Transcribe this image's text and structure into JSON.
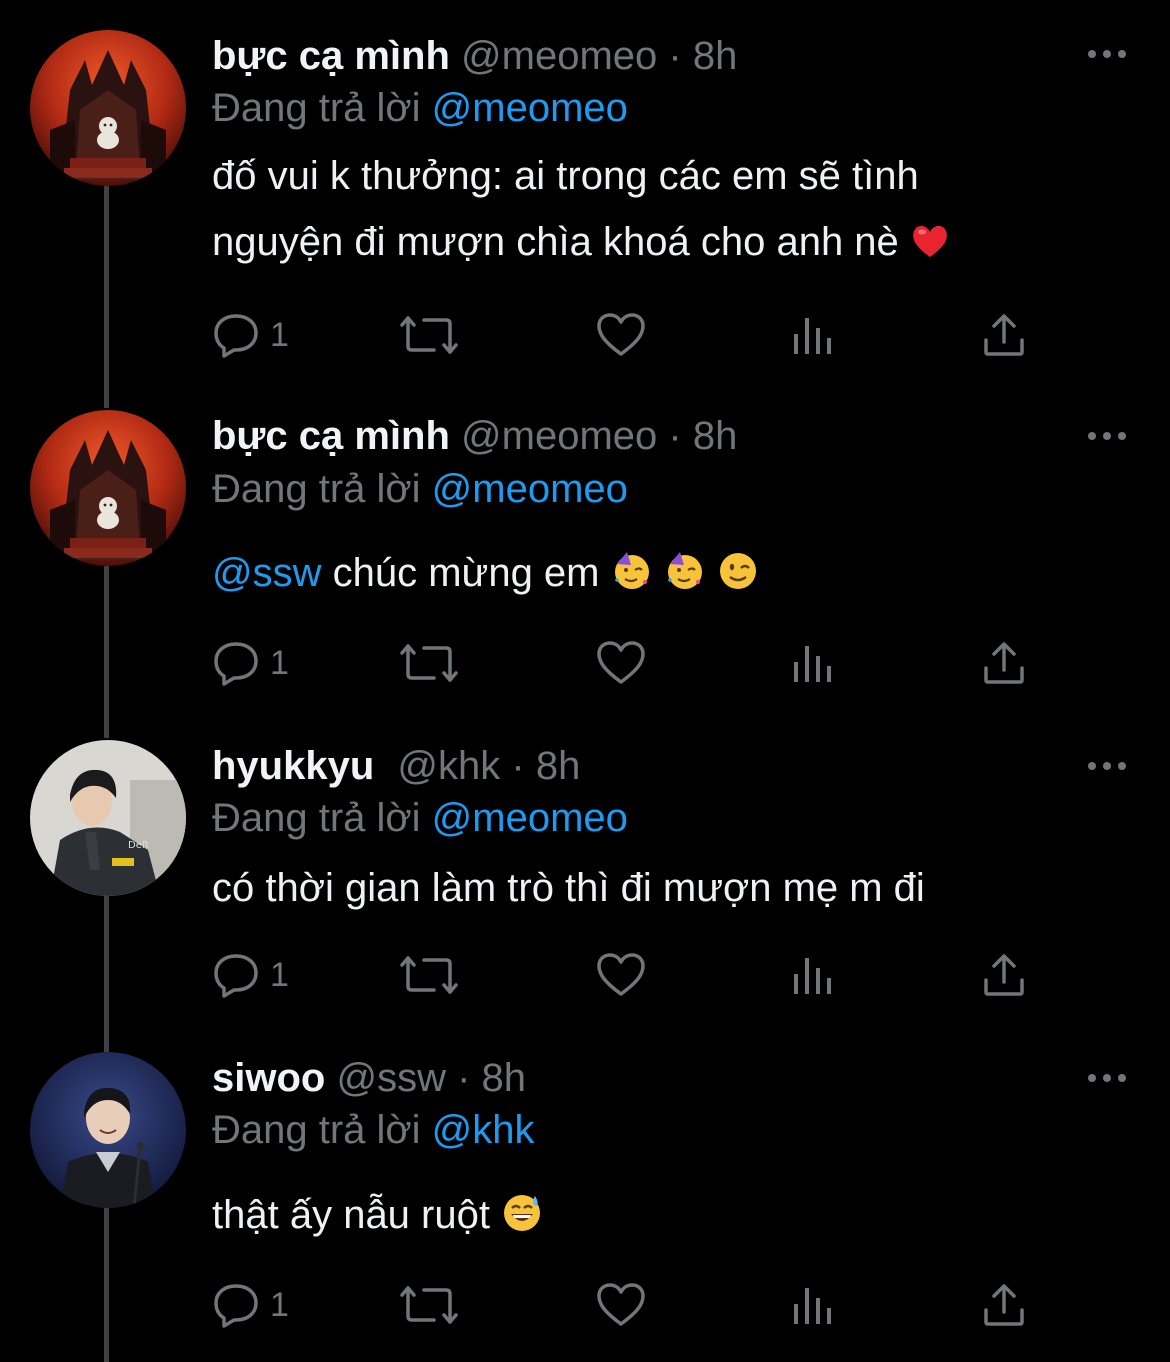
{
  "tweets": [
    {
      "name": "bực cạ mình",
      "handle": "@meomeo",
      "separator": "·",
      "time": "8h",
      "reply_prefix": "Đang trả lời",
      "reply_to": "@meomeo",
      "text_line1": "đố vui k thưởng: ai trong các em sẽ tình",
      "text_line2": "nguyện đi mượn chìa khoá cho anh nè",
      "emojis": [
        "red-heart"
      ],
      "reply_count": "1",
      "avatar": "demon-throne-cat"
    },
    {
      "name": "bực cạ mình",
      "handle": "@meomeo",
      "separator": "·",
      "time": "8h",
      "reply_prefix": "Đang trả lời",
      "reply_to": "@meomeo",
      "text_mention": "@ssw",
      "text": "chúc mừng em",
      "emojis": [
        "partying-face",
        "partying-face",
        "winking-face"
      ],
      "reply_count": "1",
      "avatar": "demon-throne-cat"
    },
    {
      "name": "hyukkyu",
      "handle": "@khk",
      "separator": "·",
      "time": "8h",
      "reply_prefix": "Đang trả lời",
      "reply_to": "@meomeo",
      "text": "có thời gian làm trò thì đi mượn mẹ m đi",
      "reply_count": "1",
      "avatar": "young-man-jacket"
    },
    {
      "name": "siwoo",
      "handle": "@ssw",
      "separator": "·",
      "time": "8h",
      "reply_prefix": "Đang trả lời",
      "reply_to": "@khk",
      "text": "thật ấy nẫu ruột",
      "emojis": [
        "grinning-face-with-sweat"
      ],
      "reply_count": "1",
      "avatar": "smiling-man-stage"
    }
  ],
  "colors": {
    "background": "#000000",
    "text": "#e7e9ea",
    "muted": "#71767b",
    "link": "#1d9bf0",
    "thread_line": "#3e4144"
  },
  "icons": [
    "reply-icon",
    "retweet-icon",
    "like-icon",
    "views-icon",
    "share-icon",
    "more-icon"
  ]
}
